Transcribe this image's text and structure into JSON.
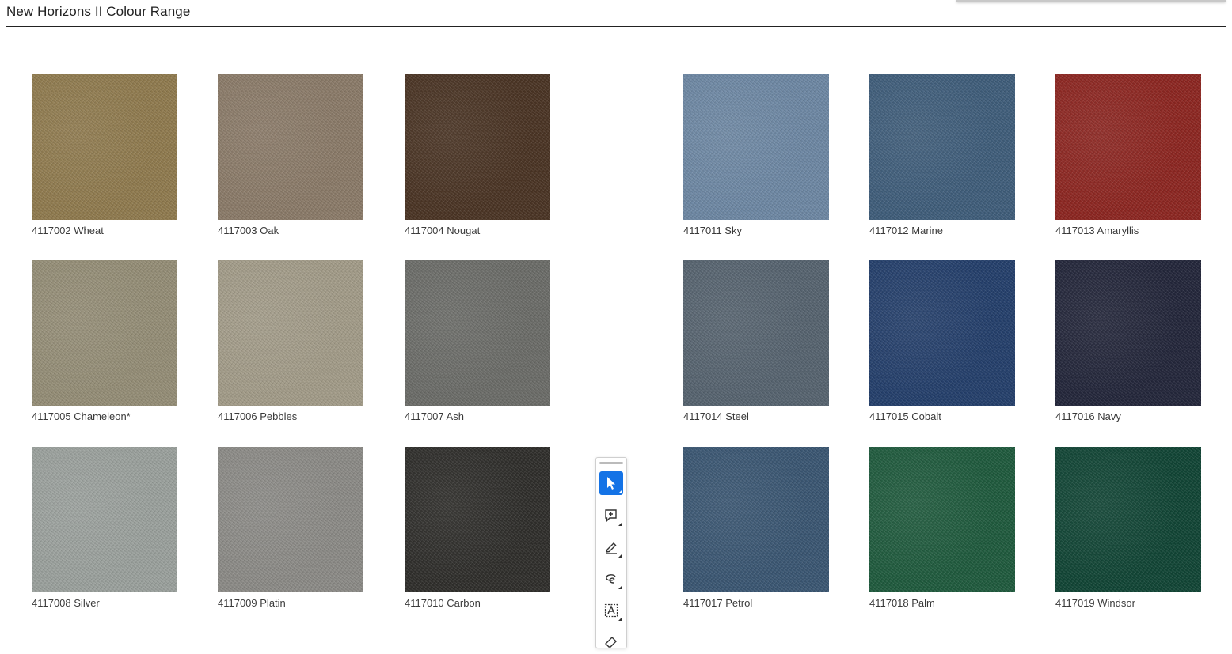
{
  "page": {
    "title": "New Horizons II Colour Range"
  },
  "swatches": [
    {
      "code_name": "4117002 Wheat",
      "color": "#8f7a4e"
    },
    {
      "code_name": "4117003 Oak",
      "color": "#8a7a68"
    },
    {
      "code_name": "4117004 Nougat",
      "color": "#4a3424"
    },
    {
      "code_name": "4117011 Sky",
      "color": "#6d87a3"
    },
    {
      "code_name": "4117012 Marine",
      "color": "#3f5d7a"
    },
    {
      "code_name": "4117013 Amaryllis",
      "color": "#8c2621"
    },
    {
      "code_name": "4117005 Chameleon*",
      "color": "#948d76"
    },
    {
      "code_name": "4117006 Pebbles",
      "color": "#a29b88"
    },
    {
      "code_name": "4117007 Ash",
      "color": "#6b6c68"
    },
    {
      "code_name": "4117014 Steel",
      "color": "#56636f"
    },
    {
      "code_name": "4117015 Cobalt",
      "color": "#243f6b"
    },
    {
      "code_name": "4117016 Navy",
      "color": "#23263a"
    },
    {
      "code_name": "4117008 Silver",
      "color": "#9aa09c"
    },
    {
      "code_name": "4117009 Platin",
      "color": "#8b8a86"
    },
    {
      "code_name": "4117010 Carbon",
      "color": "#2f2e2b"
    },
    {
      "code_name": "4117017 Petrol",
      "color": "#3a5672"
    },
    {
      "code_name": "4117018 Palm",
      "color": "#1f5a3d"
    },
    {
      "code_name": "4117019 Windsor",
      "color": "#114535"
    }
  ],
  "toolbar": {
    "accent": "#1473e6",
    "tools": [
      {
        "icon": "select-pointer-icon",
        "active": true
      },
      {
        "icon": "add-comment-icon",
        "active": false
      },
      {
        "icon": "highlight-pen-icon",
        "active": false
      },
      {
        "icon": "freehand-draw-icon",
        "active": false
      },
      {
        "icon": "text-box-icon",
        "active": false
      },
      {
        "icon": "eraser-icon",
        "active": false
      }
    ]
  }
}
